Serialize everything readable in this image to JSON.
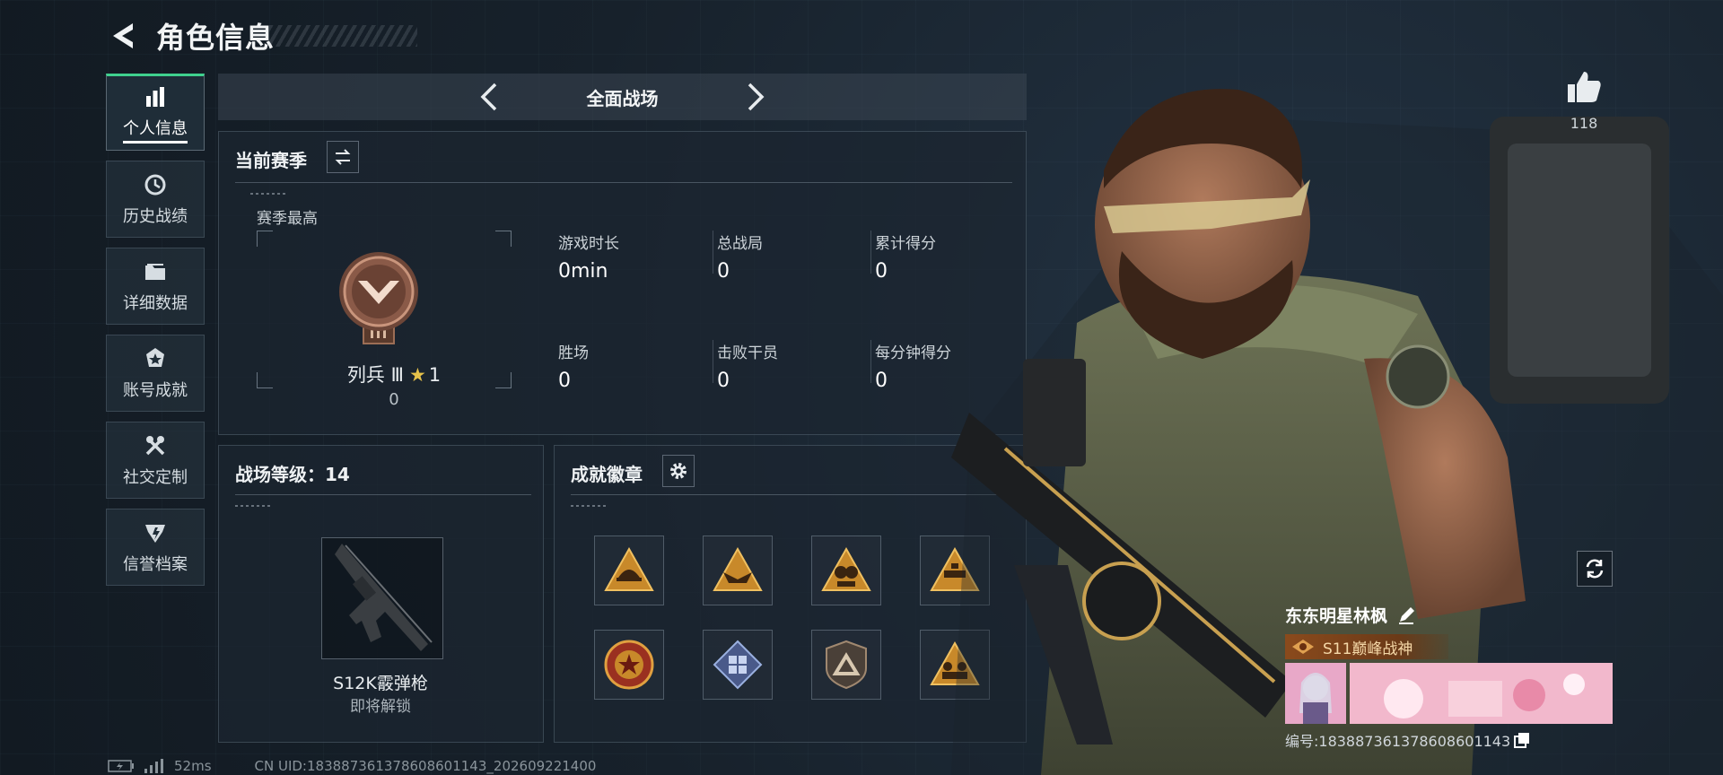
{
  "header": {
    "title": "角色信息",
    "back_icon": "back-arrow-icon"
  },
  "side_nav": {
    "items": [
      {
        "label": "个人信息",
        "icon": "bar-chart-icon",
        "active": true
      },
      {
        "label": "历史战绩",
        "icon": "history-clock-icon",
        "active": false
      },
      {
        "label": "详细数据",
        "icon": "folder-icon",
        "active": false
      },
      {
        "label": "账号成就",
        "icon": "achievement-icon",
        "active": false
      },
      {
        "label": "社交定制",
        "icon": "tools-icon",
        "active": false
      },
      {
        "label": "信誉档案",
        "icon": "reputation-icon",
        "active": false
      }
    ]
  },
  "mode_selector": {
    "label": "全面战场"
  },
  "season_panel": {
    "title": "当前赛季",
    "best_label": "赛季最高",
    "rank_name": "列兵 Ⅲ",
    "rank_stars": "1",
    "rank_points": "0",
    "stats": [
      {
        "label": "游戏时长",
        "value": "0min"
      },
      {
        "label": "总战局",
        "value": "0"
      },
      {
        "label": "累计得分",
        "value": "0"
      },
      {
        "label": "胜场",
        "value": "0"
      },
      {
        "label": "击败干员",
        "value": "0"
      },
      {
        "label": "每分钟得分",
        "value": "0"
      }
    ]
  },
  "level_panel": {
    "title": "战场等级：14",
    "weapon_name": "S12K霰弹枪",
    "weapon_status": "即将解锁"
  },
  "badges_panel": {
    "title": "成就徽章",
    "badges": [
      "helmet-badge-icon",
      "eagle-badge-icon",
      "grenade-badge-icon",
      "sniper-badge-icon",
      "medal-badge-icon",
      "crate-badge-icon",
      "shield-badge-icon",
      "squad-badge-icon"
    ]
  },
  "right_panel": {
    "likes": "118",
    "player_name": "东东明星林枫",
    "player_title": "S11巅峰战神",
    "uid_line": "编号:18388736137860860114​3"
  },
  "footer": {
    "ping": "52ms",
    "uid": "CN UID:18388736137860860114​3_202609221400"
  },
  "colors": {
    "accent_green": "#3fd18e",
    "background": "#16202a",
    "title_plate": "#8a4a1c"
  }
}
